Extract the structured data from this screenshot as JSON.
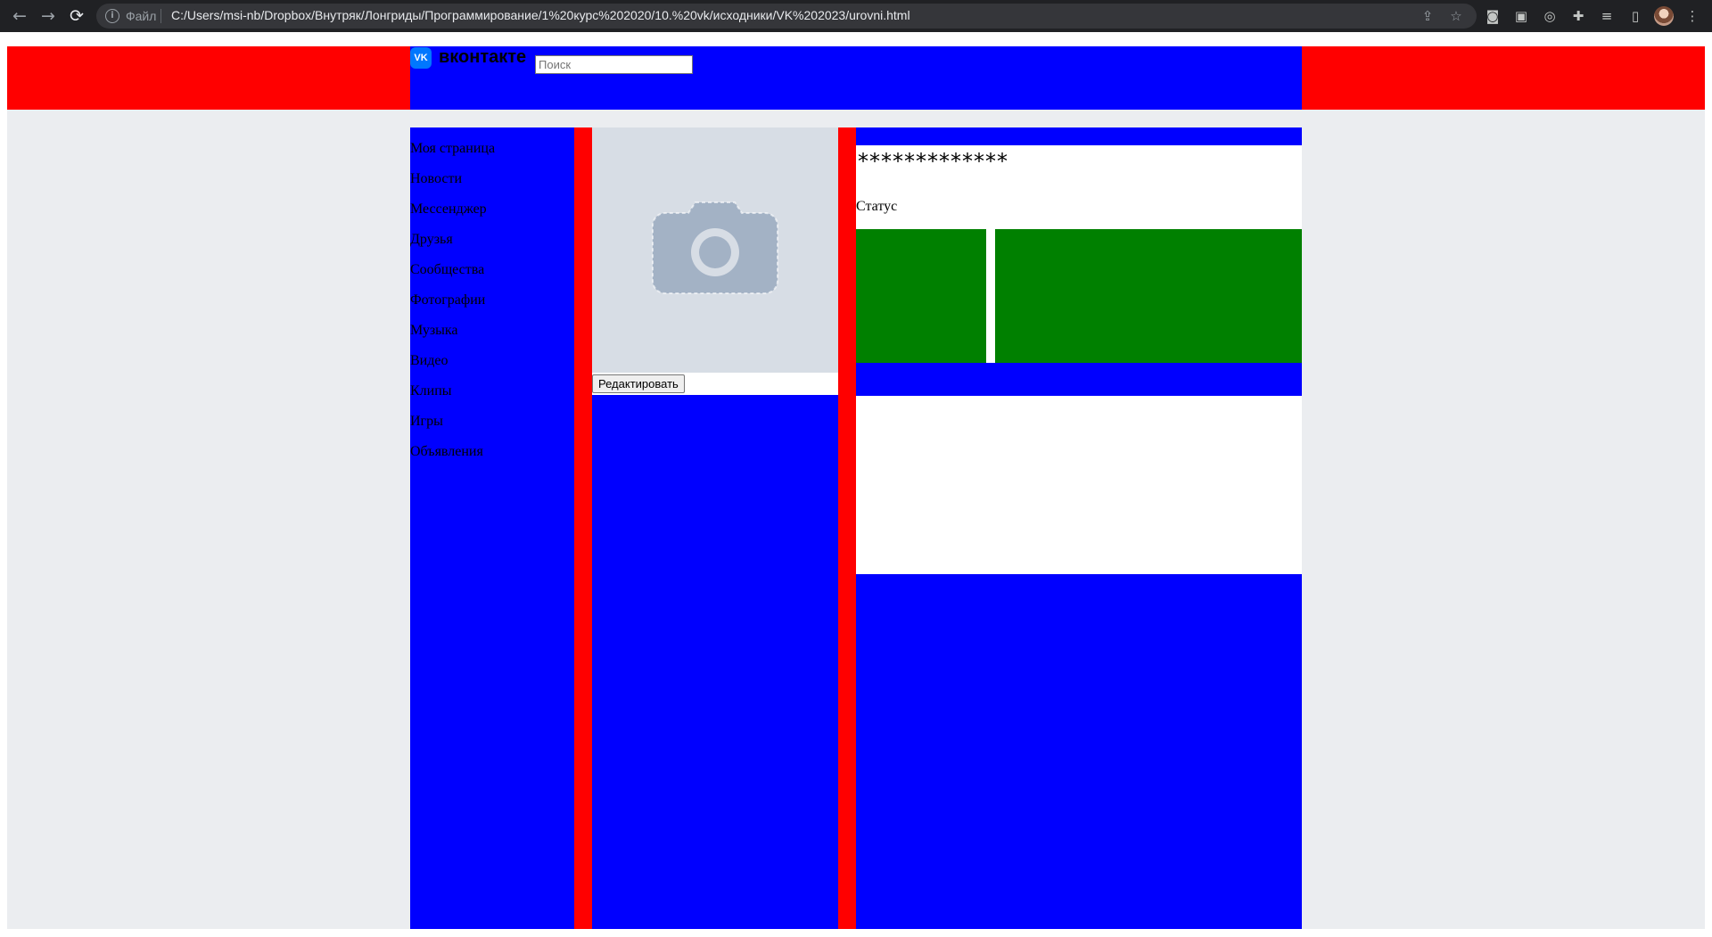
{
  "browser": {
    "nav": {
      "back_icon": "←",
      "forward_icon": "→",
      "reload_icon": "⟳"
    },
    "address_bar": {
      "info_icon": "i",
      "scheme_label": "Файл",
      "url": "C:/Users/msi-nb/Dropbox/Внутряк/Лонгриды/Программирование/1%20курс%202020/10.%20vk/исходники/VK%202023/urovni.html",
      "share_icon": "⇪",
      "bookmark_icon": "☆"
    },
    "toolbar_icons": {
      "camera": "◙",
      "ext_a": "▣",
      "target": "◎",
      "puzzle": "✚",
      "media": "≡",
      "sidebar": "▯",
      "menu": "⋮"
    }
  },
  "page": {
    "colors": {
      "header_bg": "#ff0000",
      "column_bg": "#0000ff",
      "accent_green": "#008000",
      "page_bg": "#ebedf0"
    },
    "header": {
      "logo_mark": "VK",
      "logo_text": "вконтакте",
      "search_placeholder": "Поиск"
    },
    "sidebar": {
      "items": [
        {
          "label": "Моя страница"
        },
        {
          "label": "Новости"
        },
        {
          "label": "Мессенджер"
        },
        {
          "label": "Друзья"
        },
        {
          "label": "Сообщества"
        },
        {
          "label": "Фотографии"
        },
        {
          "label": "Музыка"
        },
        {
          "label": "Видео"
        },
        {
          "label": "Клипы"
        },
        {
          "label": "Игры"
        },
        {
          "label": "Объявления"
        }
      ]
    },
    "profile": {
      "edit_label": "Редактировать",
      "name": "*************",
      "status": "Статус"
    }
  }
}
